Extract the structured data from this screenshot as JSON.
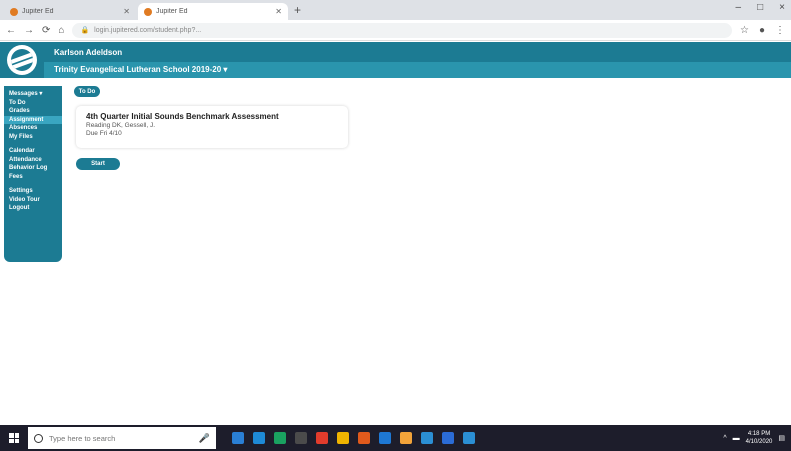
{
  "browser": {
    "tabs": [
      {
        "title": "Jupiter Ed",
        "active": false
      },
      {
        "title": "Jupiter Ed",
        "active": true
      }
    ],
    "new_tab_icon": "plus-icon",
    "url": "login.jupitered.com/student.php?...",
    "window_controls": [
      "–",
      "□",
      "×"
    ],
    "nav_icons": [
      "←",
      "→",
      "⟳",
      "⌂"
    ]
  },
  "header": {
    "user_name": "Karlson Adeldson",
    "school": "Trinity Evangelical Lutheran School 2019-20 ▾",
    "brand_color": "#1c7b93"
  },
  "sidebar": {
    "items": [
      {
        "label": "Messages ▾",
        "active": false
      },
      {
        "label": "To Do",
        "active": false
      },
      {
        "label": "Grades",
        "active": false
      },
      {
        "label": "Assignment",
        "active": true
      },
      {
        "label": "Absences",
        "active": false
      },
      {
        "label": "My Files",
        "active": false
      },
      {
        "label": "",
        "gap": true
      },
      {
        "label": "Calendar",
        "active": false
      },
      {
        "label": "Attendance",
        "active": false
      },
      {
        "label": "Behavior Log",
        "active": false
      },
      {
        "label": "Fees",
        "active": false
      },
      {
        "label": "",
        "gap": true
      },
      {
        "label": "Settings",
        "active": false
      },
      {
        "label": "Video Tour",
        "active": false
      },
      {
        "label": "Logout",
        "active": false
      }
    ]
  },
  "main": {
    "back_label": "To Do",
    "assignment": {
      "title": "4th Quarter Initial Sounds Benchmark Assessment",
      "class_teacher": "Reading DK, Gessell, J.",
      "due": "Due Fri 4/10"
    },
    "start_label": "Start"
  },
  "taskbar": {
    "search_placeholder": "Type here to search",
    "time": "4:18 PM",
    "date": "4/10/2020",
    "app_colors": [
      "#2a7fd4",
      "#1e8ad6",
      "#1aa260",
      "#4b4b4b",
      "#e23c2c",
      "#f0b400",
      "#e05a1c",
      "#1e78d4",
      "#f2a33a",
      "#2b8fd4",
      "#2b6cd6",
      "#2b8fd4"
    ]
  }
}
